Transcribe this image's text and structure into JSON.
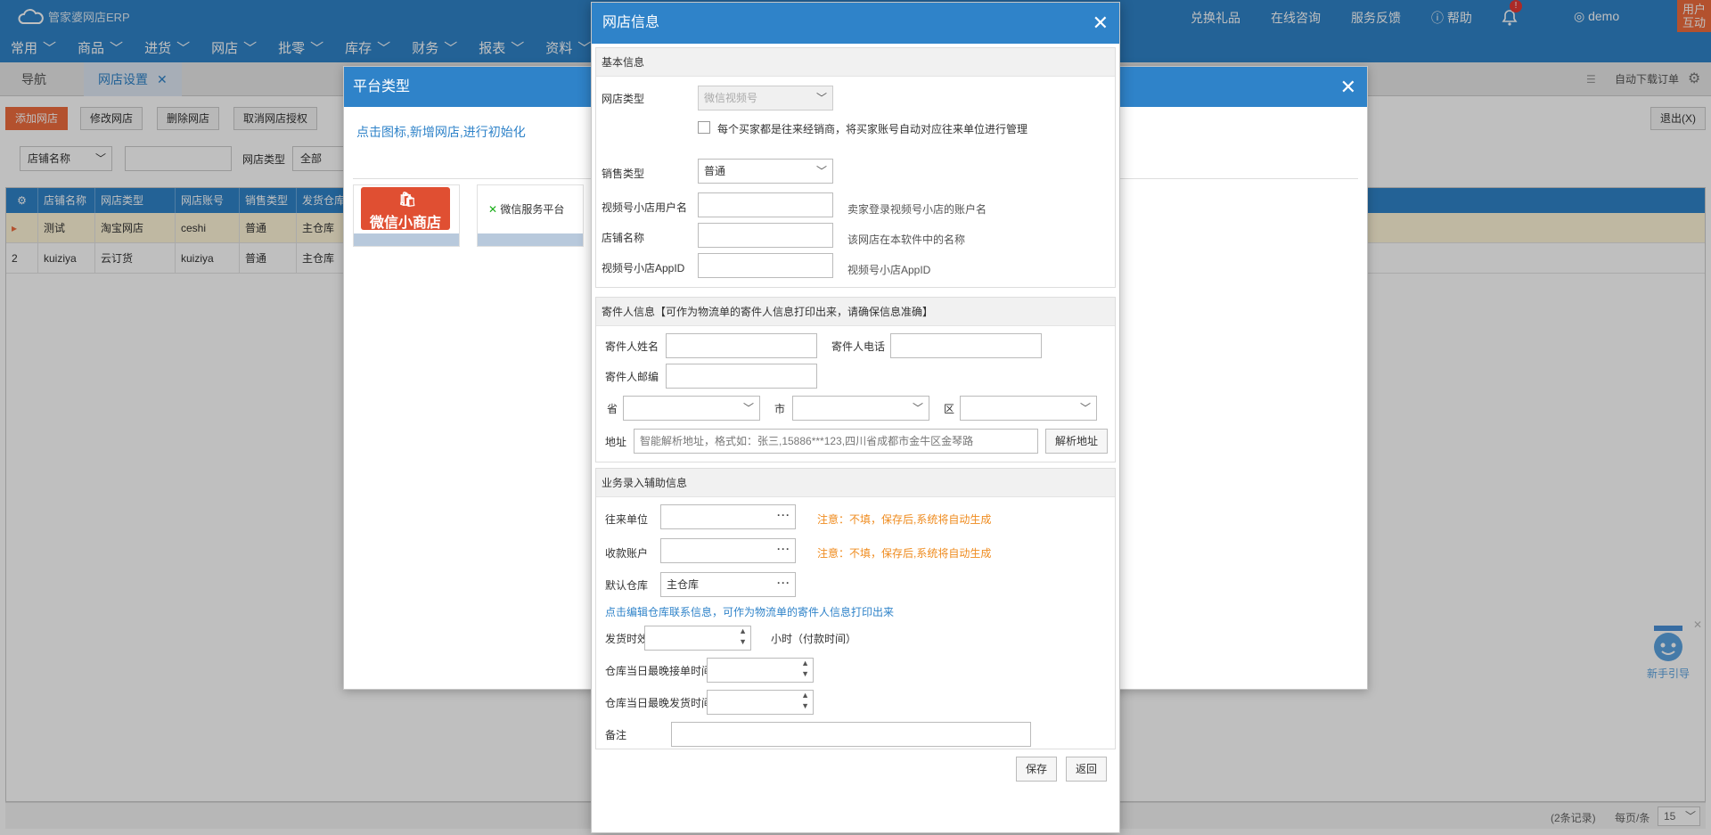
{
  "app": {
    "logo_text": "管家婆网店ERP"
  },
  "topmenu": [
    "常用",
    "商品",
    "进货",
    "网店",
    "批零",
    "库存",
    "财务",
    "报表",
    "资料"
  ],
  "toplinks": {
    "gift": "兑换礼品",
    "consult": "在线咨询",
    "feedback": "服务反馈",
    "help": "帮助",
    "user": "demo",
    "panel_line1": "用户",
    "panel_line2": "互动",
    "bell_badge": "!"
  },
  "tabs": [
    {
      "label": "导航"
    },
    {
      "label": "网店设置"
    }
  ],
  "tabbar_right": {
    "auto_download": "自动下载订单"
  },
  "toolbar": {
    "add": "添加网店",
    "edit": "修改网店",
    "delete": "删除网店",
    "cancel_auth": "取消网店授权",
    "exit": "退出(X)"
  },
  "filter": {
    "field": "店铺名称",
    "type_label": "网店类型",
    "type_value": "全部"
  },
  "grid": {
    "headers": [
      "店铺名称",
      "网店类型",
      "网店账号",
      "销售类型",
      "发货仓库"
    ],
    "rows": [
      {
        "idx": "▸",
        "name": "测试",
        "type": "淘宝网店",
        "account": "ceshi",
        "sale": "普通",
        "wh": "主仓库"
      },
      {
        "idx": "2",
        "name": "kuiziya",
        "type": "云订货",
        "account": "kuiziya",
        "sale": "普通",
        "wh": "主仓库"
      }
    ]
  },
  "footer": {
    "records": "(2条记录)",
    "per_page_label": "每页/条",
    "per_page": "15"
  },
  "guide": {
    "label": "新手引导"
  },
  "platform_dialog": {
    "title": "平台类型",
    "hint": "点击图标,新增网店,进行初始化",
    "platforms": [
      {
        "label": "微信小商店"
      },
      {
        "label": "微信服务平台"
      }
    ]
  },
  "shop_dialog": {
    "title": "网店信息",
    "basic": {
      "header": "基本信息",
      "shop_type_label": "网店类型",
      "shop_type_value": "微信视频号",
      "buyer_checkbox": "每个买家都是往来经销商，将买家账号自动对应往来单位进行管理",
      "sale_type_label": "销售类型",
      "sale_type_value": "普通",
      "username_label": "视频号小店用户名",
      "username_help": "卖家登录视频号小店的账户名",
      "store_name_label": "店铺名称",
      "store_name_help": "该网店在本软件中的名称",
      "appid_label": "视频号小店AppID",
      "appid_help": "视频号小店AppID"
    },
    "sender": {
      "header": "寄件人信息【可作为物流单的寄件人信息打印出来，请确保信息准确】",
      "name_label": "寄件人姓名",
      "phone_label": "寄件人电话",
      "zip_label": "寄件人邮编",
      "province_label": "省",
      "city_label": "市",
      "district_label": "区",
      "address_label": "地址",
      "address_placeholder": "智能解析地址，格式如：张三,15886***123,四川省成都市金牛区金琴路",
      "parse_button": "解析地址"
    },
    "business": {
      "header": "业务录入辅助信息",
      "partner_label": "往来单位",
      "partner_note": "注意：不填，保存后,系统将自动生成",
      "account_label": "收款账户",
      "account_note": "注意：不填，保存后,系统将自动生成",
      "warehouse_label": "默认仓库",
      "warehouse_value": "主仓库",
      "warehouse_link": "点击编辑仓库联系信息，可作为物流单的寄件人信息打印出来",
      "ship_time_label": "发货时效",
      "ship_time_unit": "小时（付款时间）",
      "latest_order_label": "仓库当日最晚接单时间",
      "latest_ship_label": "仓库当日最晚发货时间",
      "remark_label": "备注"
    },
    "buttons": {
      "save": "保存",
      "back": "返回"
    }
  }
}
